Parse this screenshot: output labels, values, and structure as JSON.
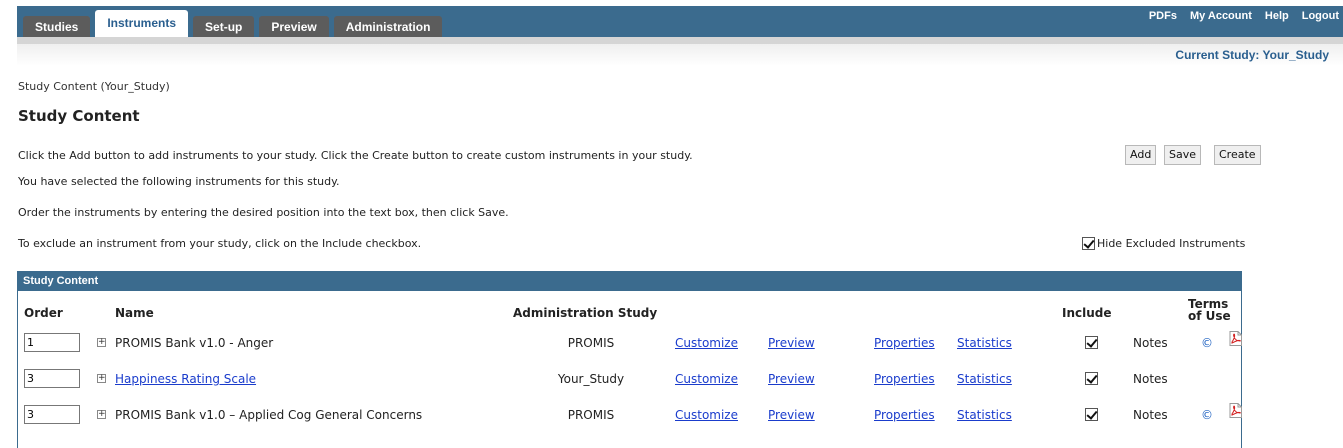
{
  "nav": {
    "tabs": [
      "Studies",
      "Instruments",
      "Set-up",
      "Preview",
      "Administration"
    ],
    "links": [
      "PDFs",
      "My Account",
      "Help",
      "Logout"
    ]
  },
  "current_study": "Current Study: Your_Study",
  "breadcrumb": "Study Content (Your_Study)",
  "page_title": "Study Content",
  "instructions": {
    "line1": "Click the Add button to add instruments to your study.  Click the Create button to create custom instruments in your study.",
    "line2": "You have selected the following instruments for this study.",
    "line3": "Order the instruments by entering the desired position into the text box, then click Save.",
    "line4": "To exclude an instrument from your study, click on the Include checkbox."
  },
  "buttons": {
    "add": "Add",
    "save": "Save",
    "create": "Create"
  },
  "hide_excluded": {
    "label": "Hide Excluded Instruments",
    "checked": true
  },
  "table": {
    "panel_title": "Study Content",
    "headers": {
      "order": "Order",
      "name": "Name",
      "admin_study": "Administration Study",
      "include": "Include",
      "terms_line1": "Terms",
      "terms_line2": "of Use"
    },
    "rows": [
      {
        "order": "1",
        "name": "PROMIS Bank v1.0 - Anger",
        "name_is_link": false,
        "admin_study": "PROMIS",
        "customize": "Customize",
        "preview": "Preview",
        "properties": "Properties",
        "statistics": "Statistics",
        "include": true,
        "notes": "Notes",
        "terms_icon": "copyright-icon",
        "pdf_icon": "pdf-icon"
      },
      {
        "order": "3",
        "name": "Happiness Rating Scale",
        "name_is_link": true,
        "admin_study": "Your_Study",
        "customize": "Customize",
        "preview": "Preview",
        "properties": "Properties",
        "statistics": "Statistics",
        "include": true,
        "notes": "Notes",
        "terms_icon": "",
        "pdf_icon": ""
      },
      {
        "order": "3",
        "name": "PROMIS Bank v1.0 – Applied Cog General Concerns",
        "name_is_link": false,
        "admin_study": "PROMIS",
        "customize": "Customize",
        "preview": "Preview",
        "properties": "Properties",
        "statistics": "Statistics",
        "include": true,
        "notes": "Notes",
        "terms_icon": "copyright-icon",
        "pdf_icon": "pdf-icon"
      }
    ]
  },
  "colors": {
    "nav_bg": "#3b6b8e",
    "link": "#1a3ccc",
    "accent_text": "#2a5f8f"
  }
}
